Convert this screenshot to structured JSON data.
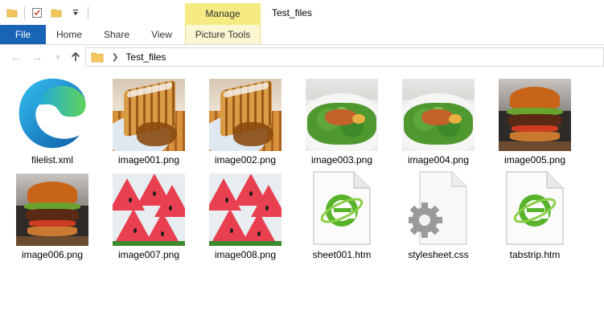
{
  "window": {
    "title": "Test_files"
  },
  "quick_access": {
    "items": [
      "folder-icon",
      "properties-icon",
      "new-folder-icon",
      "customize-dropdown"
    ]
  },
  "ribbon": {
    "context_tab": "Manage",
    "tabs": [
      {
        "label": "File"
      },
      {
        "label": "Home"
      },
      {
        "label": "Share"
      },
      {
        "label": "View"
      },
      {
        "label": "Picture Tools"
      }
    ]
  },
  "address": {
    "path": "Test_files"
  },
  "files": [
    {
      "name": "filelist.xml",
      "icon": "edge-icon"
    },
    {
      "name": "image001.png",
      "icon": "waffle-thumbnail"
    },
    {
      "name": "image002.png",
      "icon": "waffle-thumbnail"
    },
    {
      "name": "image003.png",
      "icon": "salad-thumbnail"
    },
    {
      "name": "image004.png",
      "icon": "salad-thumbnail"
    },
    {
      "name": "image005.png",
      "icon": "burger-thumbnail"
    },
    {
      "name": "image006.png",
      "icon": "burger-thumbnail"
    },
    {
      "name": "image007.png",
      "icon": "watermelon-thumbnail"
    },
    {
      "name": "image008.png",
      "icon": "watermelon-thumbnail"
    },
    {
      "name": "sheet001.htm",
      "icon": "ie-document-icon"
    },
    {
      "name": "stylesheet.css",
      "icon": "settings-document-icon"
    },
    {
      "name": "tabstrip.htm",
      "icon": "ie-document-icon"
    }
  ],
  "colors": {
    "file_tab": "#1a64b6",
    "manage_tab": "#f6eb83",
    "picture_tools_tab": "#fbf7d3"
  }
}
